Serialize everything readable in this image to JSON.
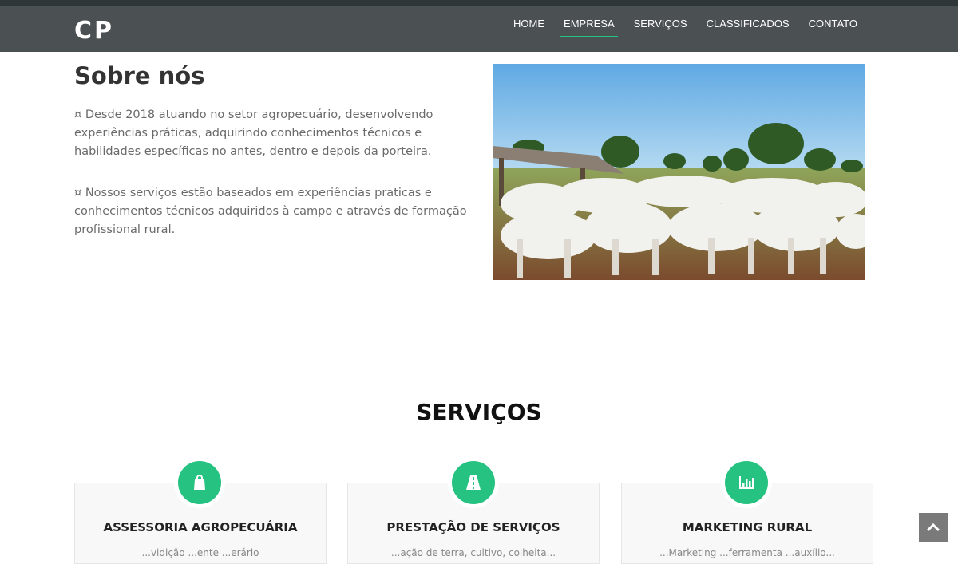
{
  "brand": {
    "logo": "CP"
  },
  "nav": {
    "items": [
      {
        "label": "HOME"
      },
      {
        "label": "EMPRESA"
      },
      {
        "label": "SERVIÇOS"
      },
      {
        "label": "CLASSIFICADOS"
      },
      {
        "label": "CONTATO"
      }
    ],
    "active": "EMPRESA"
  },
  "about": {
    "title": "Sobre nós",
    "paragraph1": "¤ Desde 2018 atuando no setor agropecuário, desenvolvendo experiências práticas, adquirindo conhecimentos técnicos e habilidades específicas no antes, dentro e depois da porteira.",
    "paragraph2": "¤ Nossos serviços estão baseados em experiências praticas e conhecimentos técnicos adquiridos à campo e através de formação profissional rural."
  },
  "services": {
    "title": "SERVIÇOS",
    "cards": [
      {
        "title": "ASSESSORIA AGROPECUÁRIA",
        "icon": "shopping-bag-icon",
        "text": "...vidição ...ente ...erário"
      },
      {
        "title": "PRESTAÇÃO DE SERVIÇOS",
        "icon": "road-icon",
        "text": "...ação de terra, cultivo, colheita..."
      },
      {
        "title": "MARKETING RURAL",
        "icon": "bar-chart-icon",
        "text": "...Marketing ...ferramenta ...auxílio..."
      }
    ]
  },
  "colors": {
    "accent": "#26c281",
    "navbar": "#4b5052",
    "scrollTop": "#7a7a7a"
  }
}
